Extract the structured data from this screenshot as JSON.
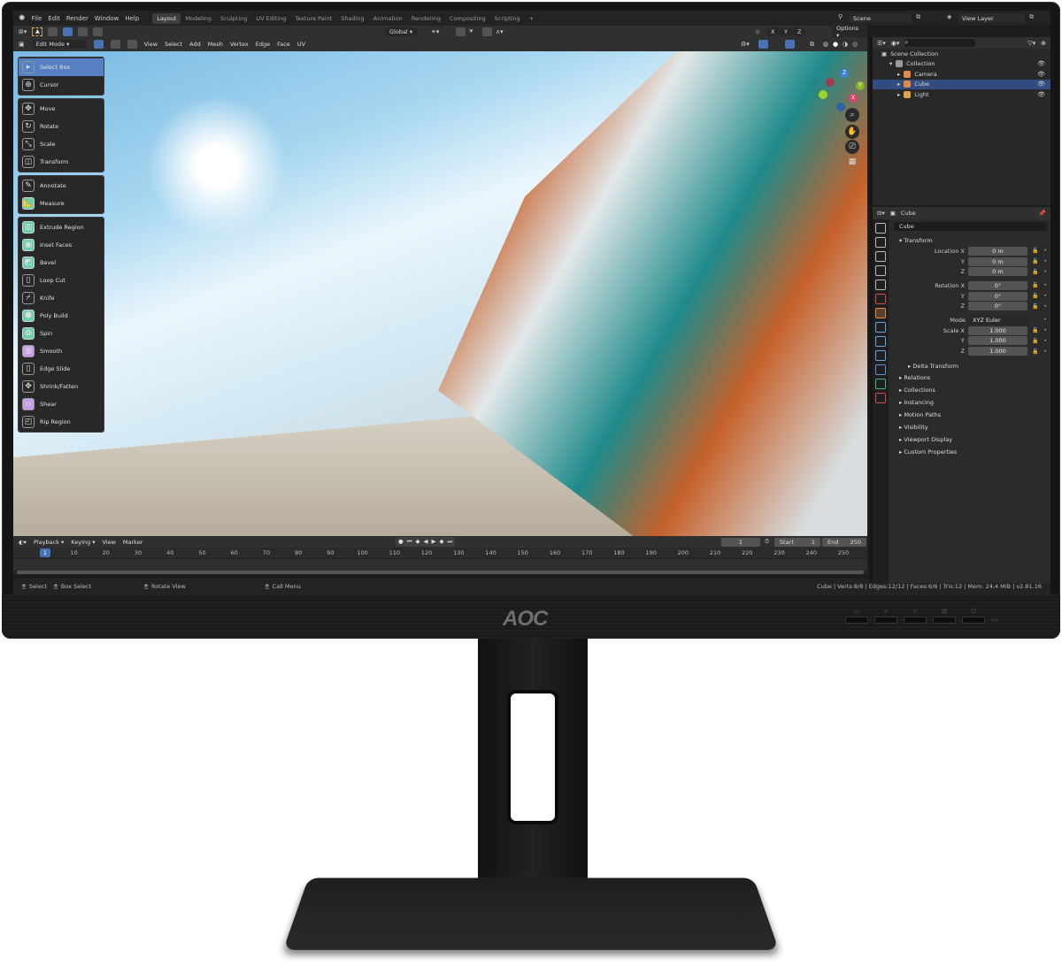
{
  "app": {
    "menu": [
      "File",
      "Edit",
      "Render",
      "Window",
      "Help"
    ],
    "workspaces": [
      "Layout",
      "Modeling",
      "Sculpting",
      "UV Editing",
      "Texture Paint",
      "Shading",
      "Animation",
      "Rendering",
      "Compositing",
      "Scripting",
      "+"
    ],
    "active_workspace": "Layout",
    "scene": "Scene",
    "view_layer": "View Layer"
  },
  "header": {
    "mode": "Edit Mode",
    "menus": [
      "View",
      "Select",
      "Add",
      "Mesh",
      "Vertex",
      "Edge",
      "Face",
      "UV"
    ],
    "orientation": "Global",
    "options": "Options",
    "axes": [
      "X",
      "Y",
      "Z"
    ]
  },
  "toolbar": {
    "groups": [
      [
        {
          "label": "Select Box",
          "icon": "select-box-icon",
          "active": true
        },
        {
          "label": "Cursor",
          "icon": "cursor-icon"
        }
      ],
      [
        {
          "label": "Move",
          "icon": "move-icon"
        },
        {
          "label": "Rotate",
          "icon": "rotate-icon"
        },
        {
          "label": "Scale",
          "icon": "scale-icon"
        },
        {
          "label": "Transform",
          "icon": "transform-icon"
        }
      ],
      [
        {
          "label": "Annotate",
          "icon": "annotate-icon"
        },
        {
          "label": "Measure",
          "icon": "measure-icon"
        }
      ],
      [
        {
          "label": "Extrude Region",
          "icon": "extrude-icon"
        },
        {
          "label": "Inset Faces",
          "icon": "inset-icon"
        },
        {
          "label": "Bevel",
          "icon": "bevel-icon"
        },
        {
          "label": "Loop Cut",
          "icon": "loop-cut-icon"
        },
        {
          "label": "Knife",
          "icon": "knife-icon"
        },
        {
          "label": "Poly Build",
          "icon": "poly-build-icon"
        },
        {
          "label": "Spin",
          "icon": "spin-icon"
        },
        {
          "label": "Smooth",
          "icon": "smooth-icon"
        },
        {
          "label": "Edge Slide",
          "icon": "edge-slide-icon"
        },
        {
          "label": "Shrink/Fatten",
          "icon": "shrink-fatten-icon"
        },
        {
          "label": "Shear",
          "icon": "shear-icon"
        },
        {
          "label": "Rip Region",
          "icon": "rip-region-icon"
        }
      ]
    ]
  },
  "gizmo": {
    "x": "X",
    "y": "Y",
    "z": "Z"
  },
  "outliner": {
    "root": "Scene Collection",
    "items": [
      {
        "label": "Collection",
        "indent": 1,
        "color": "#9a9a9a"
      },
      {
        "label": "Camera",
        "indent": 2,
        "color": "#e0894a"
      },
      {
        "label": "Cube",
        "indent": 2,
        "color": "#e0894a",
        "selected": true
      },
      {
        "label": "Light",
        "indent": 2,
        "color": "#e0a54a"
      }
    ]
  },
  "properties": {
    "object": "Cube",
    "name": "Cube",
    "transform_title": "Transform",
    "location": {
      "label": "Location X",
      "values": [
        "0 m",
        "0 m",
        "0 m"
      ]
    },
    "rotation": {
      "label": "Rotation X",
      "values": [
        "0°",
        "0°",
        "0°"
      ]
    },
    "mode": {
      "label": "Mode",
      "value": "XYZ Euler"
    },
    "scale": {
      "label": "Scale X",
      "values": [
        "1.000",
        "1.000",
        "1.000"
      ]
    },
    "axis_labels": [
      "Y",
      "Z"
    ],
    "delta": "Delta Transform",
    "sections": [
      "Relations",
      "Collections",
      "Instancing",
      "Motion Paths",
      "Visibility",
      "Viewport Display",
      "Custom Properties"
    ],
    "tab_colors": [
      "#bbb",
      "#bbb",
      "#bbb",
      "#bbb",
      "#bbb",
      "#d0504f",
      "#e58a3a",
      "#6ba4e6",
      "#6ba4e6",
      "#6ba4e6",
      "#5a8fd1",
      "#40b38a",
      "#d0504f"
    ]
  },
  "timeline": {
    "menus": [
      "Playback",
      "Keying",
      "View",
      "Marker"
    ],
    "current_frame": "1",
    "start_label": "Start",
    "start": "1",
    "end_label": "End",
    "end": "250",
    "ticks": [
      "10",
      "20",
      "30",
      "40",
      "50",
      "60",
      "70",
      "80",
      "90",
      "100",
      "110",
      "120",
      "130",
      "140",
      "150",
      "160",
      "170",
      "180",
      "190",
      "200",
      "210",
      "220",
      "230",
      "240",
      "250"
    ]
  },
  "statusbar": {
    "select": "Select",
    "box_select": "Box Select",
    "rotate_view": "Rotate View",
    "call_menu": "Call Menu",
    "stats": "Cube | Verts:8/8 | Edges:12/12 | Faces:6/6 | Tris:12 | Mem: 24.4 MiB | v2.81.16"
  },
  "monitor": {
    "brand": "AOC",
    "buttons": [
      "▭",
      "<",
      ">",
      "▤",
      "⏻"
    ]
  }
}
